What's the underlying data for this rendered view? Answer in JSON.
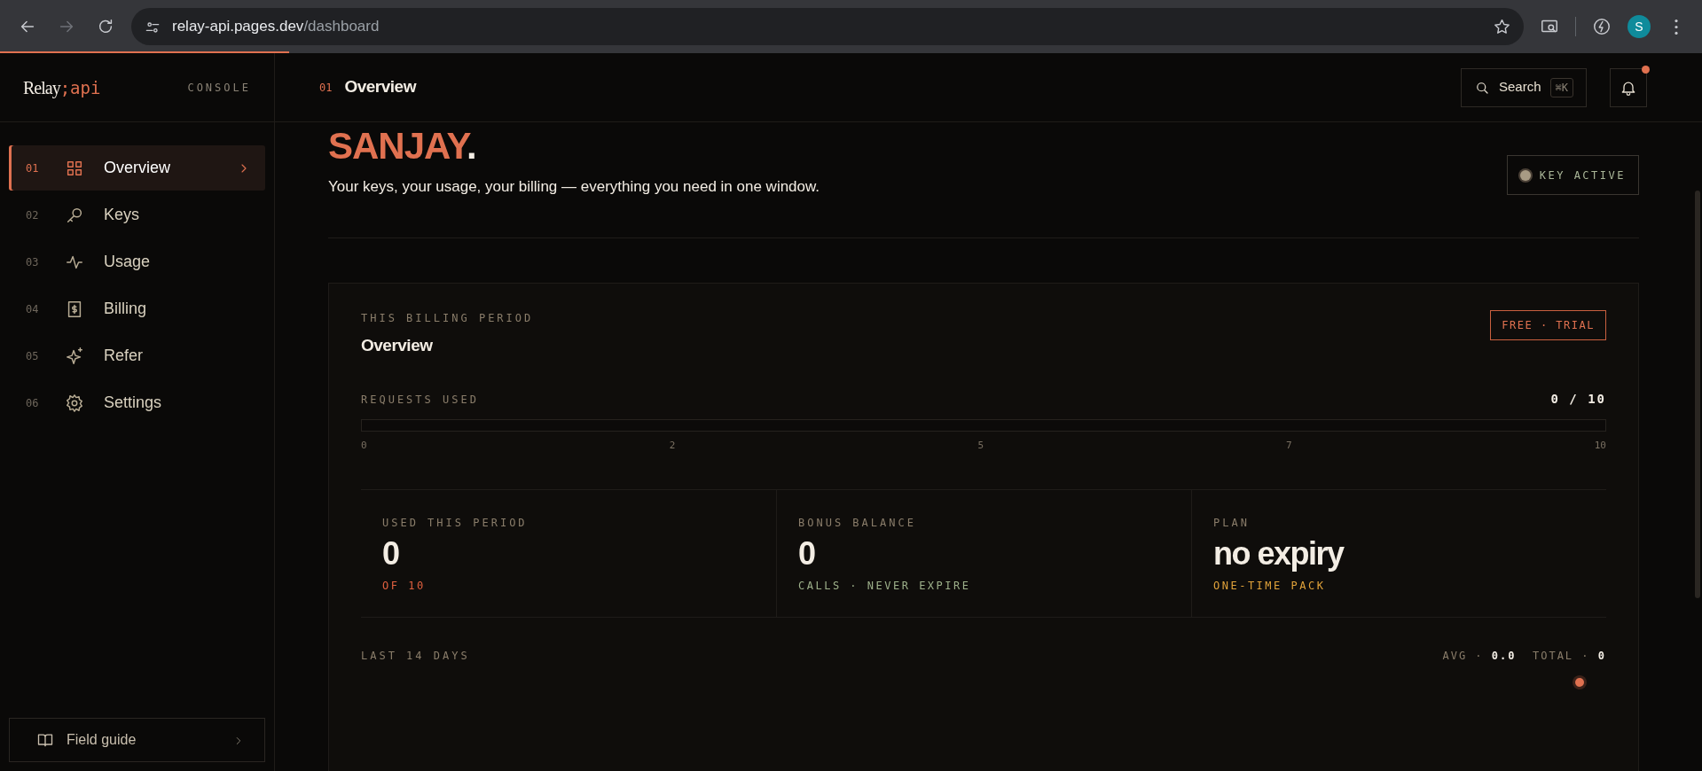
{
  "browser": {
    "url_host": "relay-api.pages.dev",
    "url_path": "/dashboard",
    "forward_disabled": true,
    "profile_initial": "S",
    "load_progress": {
      "level": 0.17
    }
  },
  "sidebar": {
    "logo_word": "Relay",
    "logo_code": ";api",
    "tag": "CONSOLE",
    "items": [
      {
        "number": "01",
        "label": "Overview",
        "kind": "grid",
        "selected": true
      },
      {
        "number": "02",
        "label": "Keys",
        "kind": "key",
        "selected": false
      },
      {
        "number": "03",
        "label": "Usage",
        "kind": "pulse",
        "selected": false
      },
      {
        "number": "04",
        "label": "Billing",
        "kind": "receipt",
        "selected": false
      },
      {
        "number": "05",
        "label": "Refer",
        "kind": "sparkle",
        "selected": false
      },
      {
        "number": "06",
        "label": "Settings",
        "kind": "gear",
        "selected": false
      }
    ],
    "footer_link": "Field guide"
  },
  "header": {
    "number": "01",
    "title": "Overview",
    "search_label": "Search",
    "search_shortcut": "⌘K",
    "notifications_unread": true
  },
  "hero": {
    "name": "SANJAY",
    "name_end": ".",
    "subtitle": "Your keys, your usage, your billing — everything you need in one window.",
    "key_status": {
      "label": "KEY ACTIVE",
      "active": true
    }
  },
  "billing": {
    "eyebrow": "THIS BILLING PERIOD",
    "title": "Overview",
    "plan_badge": "FREE · TRIAL",
    "requests": {
      "label": "REQUESTS USED",
      "reading": "0 / 10",
      "level": 0,
      "ticks": [
        "0",
        "2",
        "5",
        "7",
        "10"
      ]
    },
    "stats": [
      {
        "label": "USED THIS PERIOD",
        "value": "0",
        "note": "OF 10",
        "color": "#e0603f"
      },
      {
        "label": "BONUS BALANCE",
        "value": "0",
        "note": "CALLS · NEVER EXPIRE",
        "color": "#9db08a"
      },
      {
        "label": "PLAN",
        "value": "no expiry",
        "note": "ONE-TIME PACK",
        "color": "#e0a23a"
      }
    ],
    "history": {
      "label": "LAST 14 DAYS",
      "avg_label": "AVG ·",
      "avg": "0.0",
      "total_label": "TOTAL ·",
      "total": "0"
    }
  }
}
